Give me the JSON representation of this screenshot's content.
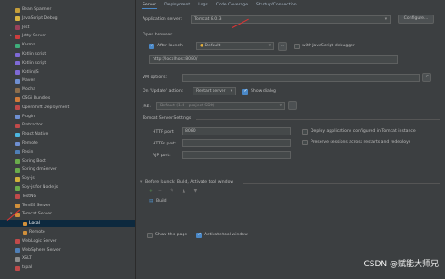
{
  "tree": {
    "items": [
      {
        "label": "Bean Spanner",
        "color": "#c59e3a"
      },
      {
        "label": "JavaScript Debug",
        "color": "#d8b443"
      },
      {
        "label": "Jest",
        "color": "#99425b"
      },
      {
        "label": "Jetty Server",
        "color": "#cc3e3e"
      },
      {
        "label": "Karma",
        "color": "#3fae7a"
      },
      {
        "label": "Kotlin script",
        "color": "#7f6ad6"
      },
      {
        "label": "Kotlin script",
        "color": "#7f6ad6"
      },
      {
        "label": "Kotlin/JS",
        "color": "#7f6ad6"
      },
      {
        "label": "Maven",
        "color": "#6f8fd1"
      },
      {
        "label": "Mocha",
        "color": "#8d6e4c"
      },
      {
        "label": "OSGi Bundles",
        "color": "#d17b3b"
      },
      {
        "label": "OpenShift Deployment",
        "color": "#c04a4a"
      },
      {
        "label": "Plugin",
        "color": "#6f8fd1"
      },
      {
        "label": "Protractor",
        "color": "#c04a4a"
      },
      {
        "label": "React Native",
        "color": "#4db6e0"
      },
      {
        "label": "Remote",
        "color": "#6f8fd1"
      },
      {
        "label": "Resin",
        "color": "#4f7fb7"
      },
      {
        "label": "Spring Boot",
        "color": "#6aab4c"
      },
      {
        "label": "Spring dmServer",
        "color": "#6aab4c"
      },
      {
        "label": "Spy-js",
        "color": "#d1b13b"
      },
      {
        "label": "Spy-js for Node.js",
        "color": "#6aab4c"
      },
      {
        "label": "TestNG",
        "color": "#c04a4a"
      },
      {
        "label": "TomEE Server",
        "color": "#d1903b"
      },
      {
        "label": "Tomcat Server",
        "color": "#d1903b"
      },
      {
        "label": "Local",
        "color": "#d1903b"
      },
      {
        "label": "Remote",
        "color": "#d1903b"
      },
      {
        "label": "WebLogic Server",
        "color": "#c04a4a"
      },
      {
        "label": "WebSphere Server",
        "color": "#4f7fb7"
      },
      {
        "label": "XSLT",
        "color": "#8d8d8d"
      },
      {
        "label": "tcpal",
        "color": "#c04a4a"
      }
    ],
    "selected_index": 24
  },
  "tabs": [
    "Server",
    "Deployment",
    "Logs",
    "Code Coverage",
    "Startup/Connection"
  ],
  "form": {
    "app_server_label": "Application server:",
    "app_server_value": "Tomcat 8.0.3",
    "configure_label": "Configure...",
    "open_browser_label": "Open browser",
    "after_launch_label": "After launch",
    "browser_value": "Default",
    "js_debugger_label": "with JavaScript debugger",
    "url_value": "http://localhost:8080/",
    "vm_options_label": "VM options:",
    "on_update_label": "On 'Update' action:",
    "on_update_value": "Restart server",
    "show_dialog_label": "Show dialog",
    "jre_label": "JRE:",
    "jre_value": "Default (1.8 - project SDK)",
    "tomcat_settings_label": "Tomcat Server Settings",
    "http_port_label": "HTTP port:",
    "http_port_value": "8080",
    "https_port_label": "HTTPs port:",
    "ajp_port_label": "AJP port:",
    "deploy_apps_label": "Deploy applications configured in Tomcat instance",
    "preserve_sessions_label": "Preserve sessions across restarts and redeploys",
    "before_launch_label": "Before launch: Build, Activate tool window",
    "build_label": "Build",
    "show_page_label": "Show this page",
    "activate_tool_label": "Activate tool window"
  },
  "watermark": "CSDN @赋能大师兄"
}
